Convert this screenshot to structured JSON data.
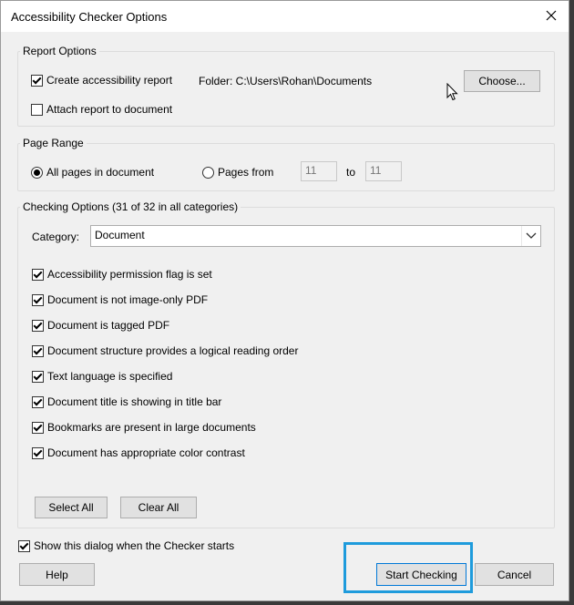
{
  "window": {
    "title": "Accessibility Checker Options"
  },
  "report_options": {
    "legend": "Report Options",
    "create_report": {
      "label": "Create accessibility report",
      "checked": true
    },
    "folder_text": "Folder: C:\\Users\\Rohan\\Documents",
    "choose_label": "Choose...",
    "attach_report": {
      "label": "Attach report to document",
      "checked": false
    }
  },
  "page_range": {
    "legend": "Page Range",
    "all_pages": {
      "label": "All pages in document",
      "selected": true
    },
    "pages_from": {
      "label": "Pages from",
      "selected": false
    },
    "from_value": "11",
    "to_label": "to",
    "to_value": "11"
  },
  "checking_options": {
    "legend": "Checking Options (31 of 32 in all categories)",
    "category_label": "Category:",
    "category_value": "Document",
    "items": [
      {
        "label": "Accessibility permission flag is set",
        "checked": true
      },
      {
        "label": "Document is not image-only PDF",
        "checked": true
      },
      {
        "label": "Document is tagged PDF",
        "checked": true
      },
      {
        "label": "Document structure provides a logical reading order",
        "checked": true
      },
      {
        "label": "Text language is specified",
        "checked": true
      },
      {
        "label": "Document title is showing in title bar",
        "checked": true
      },
      {
        "label": "Bookmarks are present in large documents",
        "checked": true
      },
      {
        "label": "Document has appropriate color contrast",
        "checked": true
      }
    ],
    "select_all_label": "Select All",
    "clear_all_label": "Clear All"
  },
  "footer": {
    "show_dialog": {
      "label": "Show this dialog when the Checker starts",
      "checked": true
    },
    "help_label": "Help",
    "start_checking_label": "Start Checking",
    "cancel_label": "Cancel"
  },
  "icons": {
    "close": "close-icon",
    "dropdown": "chevron-down-icon",
    "cursor": "mouse-pointer-icon",
    "checkmark": "checkmark-icon"
  },
  "colors": {
    "dialog_bg": "#f0f0f0",
    "highlight": "#1e9bdc",
    "default_button_border": "#0078d7"
  }
}
